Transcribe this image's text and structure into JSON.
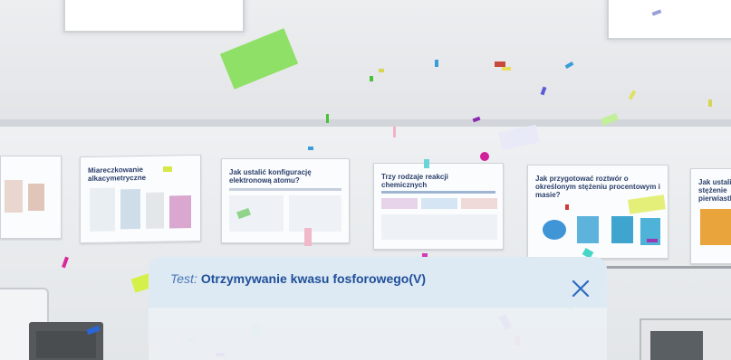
{
  "dialog": {
    "label": "Test:",
    "title": "Otrzymywanie kwasu fosforowego(V)",
    "close_icon": "close-icon"
  },
  "posters": [
    {
      "title": "Miareczkowanie alkacymetryczne"
    },
    {
      "title": "Jak ustalić konfigurację elektronową atomu?"
    },
    {
      "title": "Trzy rodzaje reakcji chemicznych"
    },
    {
      "title": "Jak przygotować roztwór o określonym stężeniu procentowym i masie?"
    },
    {
      "title": "Jak ustalić stężenie pierwiastków"
    }
  ],
  "colors": {
    "accent": "#2a5aa5",
    "close": "#2e6bbf"
  }
}
